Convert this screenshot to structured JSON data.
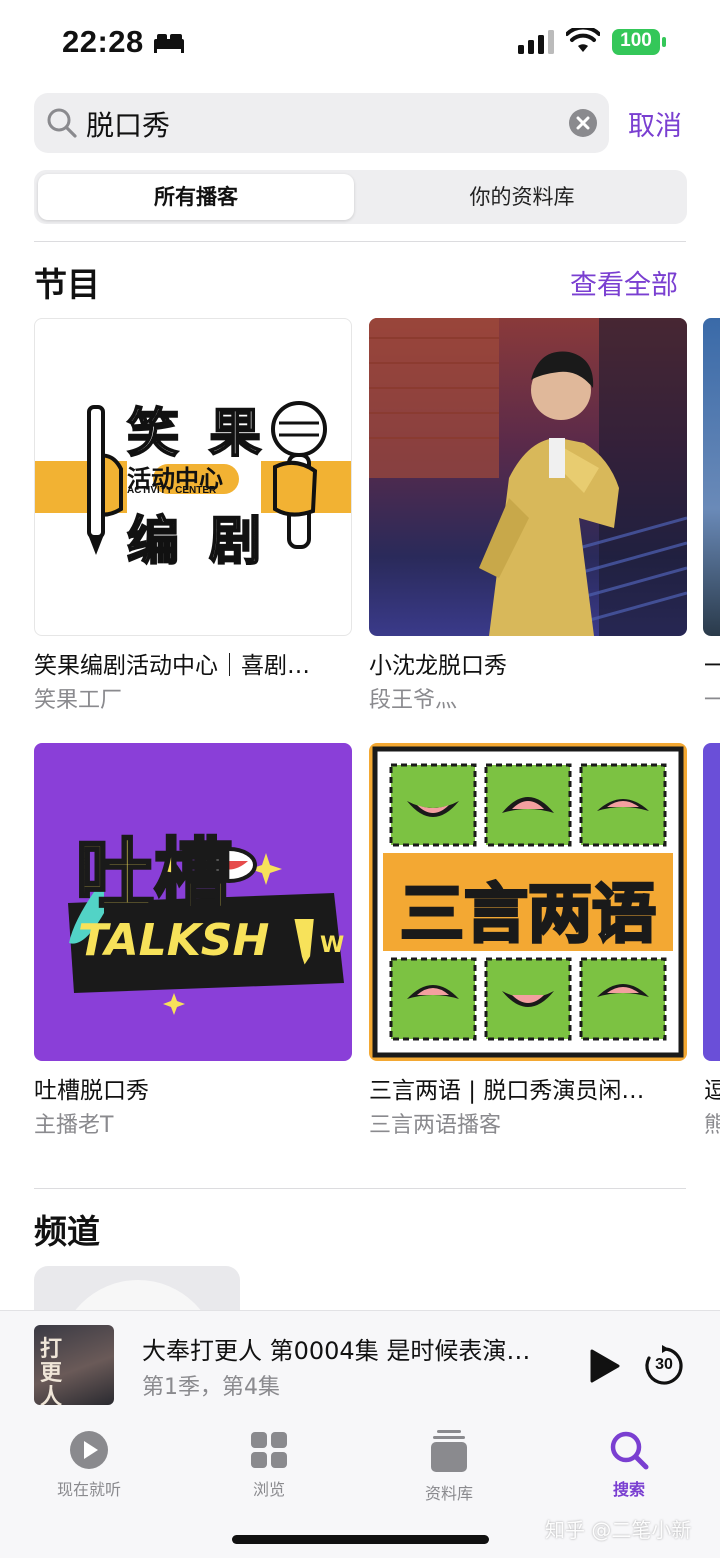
{
  "status_bar": {
    "time": "22:28",
    "battery": "100"
  },
  "search": {
    "query": "脱口秀",
    "cancel_label": "取消"
  },
  "scope": {
    "options": [
      "所有播客",
      "你的资料库"
    ],
    "selected": "所有播客"
  },
  "shows_section": {
    "title": "节目",
    "see_all_label": "查看全部",
    "items": [
      {
        "title": "笑果编剧活动中心｜喜剧…",
        "author": "笑果工厂",
        "art_text": [
          "笑 果",
          "活动中心",
          "ACTIVITY  CENTER",
          "编 剧"
        ]
      },
      {
        "title": "小沈龙脱口秀",
        "author": "段王爷灬"
      },
      {
        "title": "吐槽脱口秀",
        "author": "主播老T",
        "art_text": [
          "吐槽",
          "TALKSH",
          "W"
        ]
      },
      {
        "title": "三言两语 | 脱口秀演员闲…",
        "author": "三言两语播客",
        "art_text": [
          "三言两语"
        ]
      }
    ],
    "peek_row1": {
      "title": "一",
      "author": "一"
    },
    "peek_row2": {
      "title": "逗",
      "author": "熊"
    }
  },
  "channels_section": {
    "title": "频道"
  },
  "now_playing": {
    "title": "大奉打更人 第0004集 是时候表演…",
    "subtitle": "第1季，第4集",
    "art_text": "打更人",
    "skip_seconds": "30"
  },
  "tab_bar": {
    "items": [
      {
        "label": "现在就听",
        "icon": "play-circle-icon"
      },
      {
        "label": "浏览",
        "icon": "grid-icon"
      },
      {
        "label": "资料库",
        "icon": "library-stack-icon"
      },
      {
        "label": "搜索",
        "icon": "search-icon"
      }
    ],
    "active": "搜索"
  },
  "watermark": "知乎 @二笔小新",
  "colors": {
    "accent": "#7a3fd1",
    "battery": "#34c759",
    "secondary_text": "#8a8a8e"
  }
}
